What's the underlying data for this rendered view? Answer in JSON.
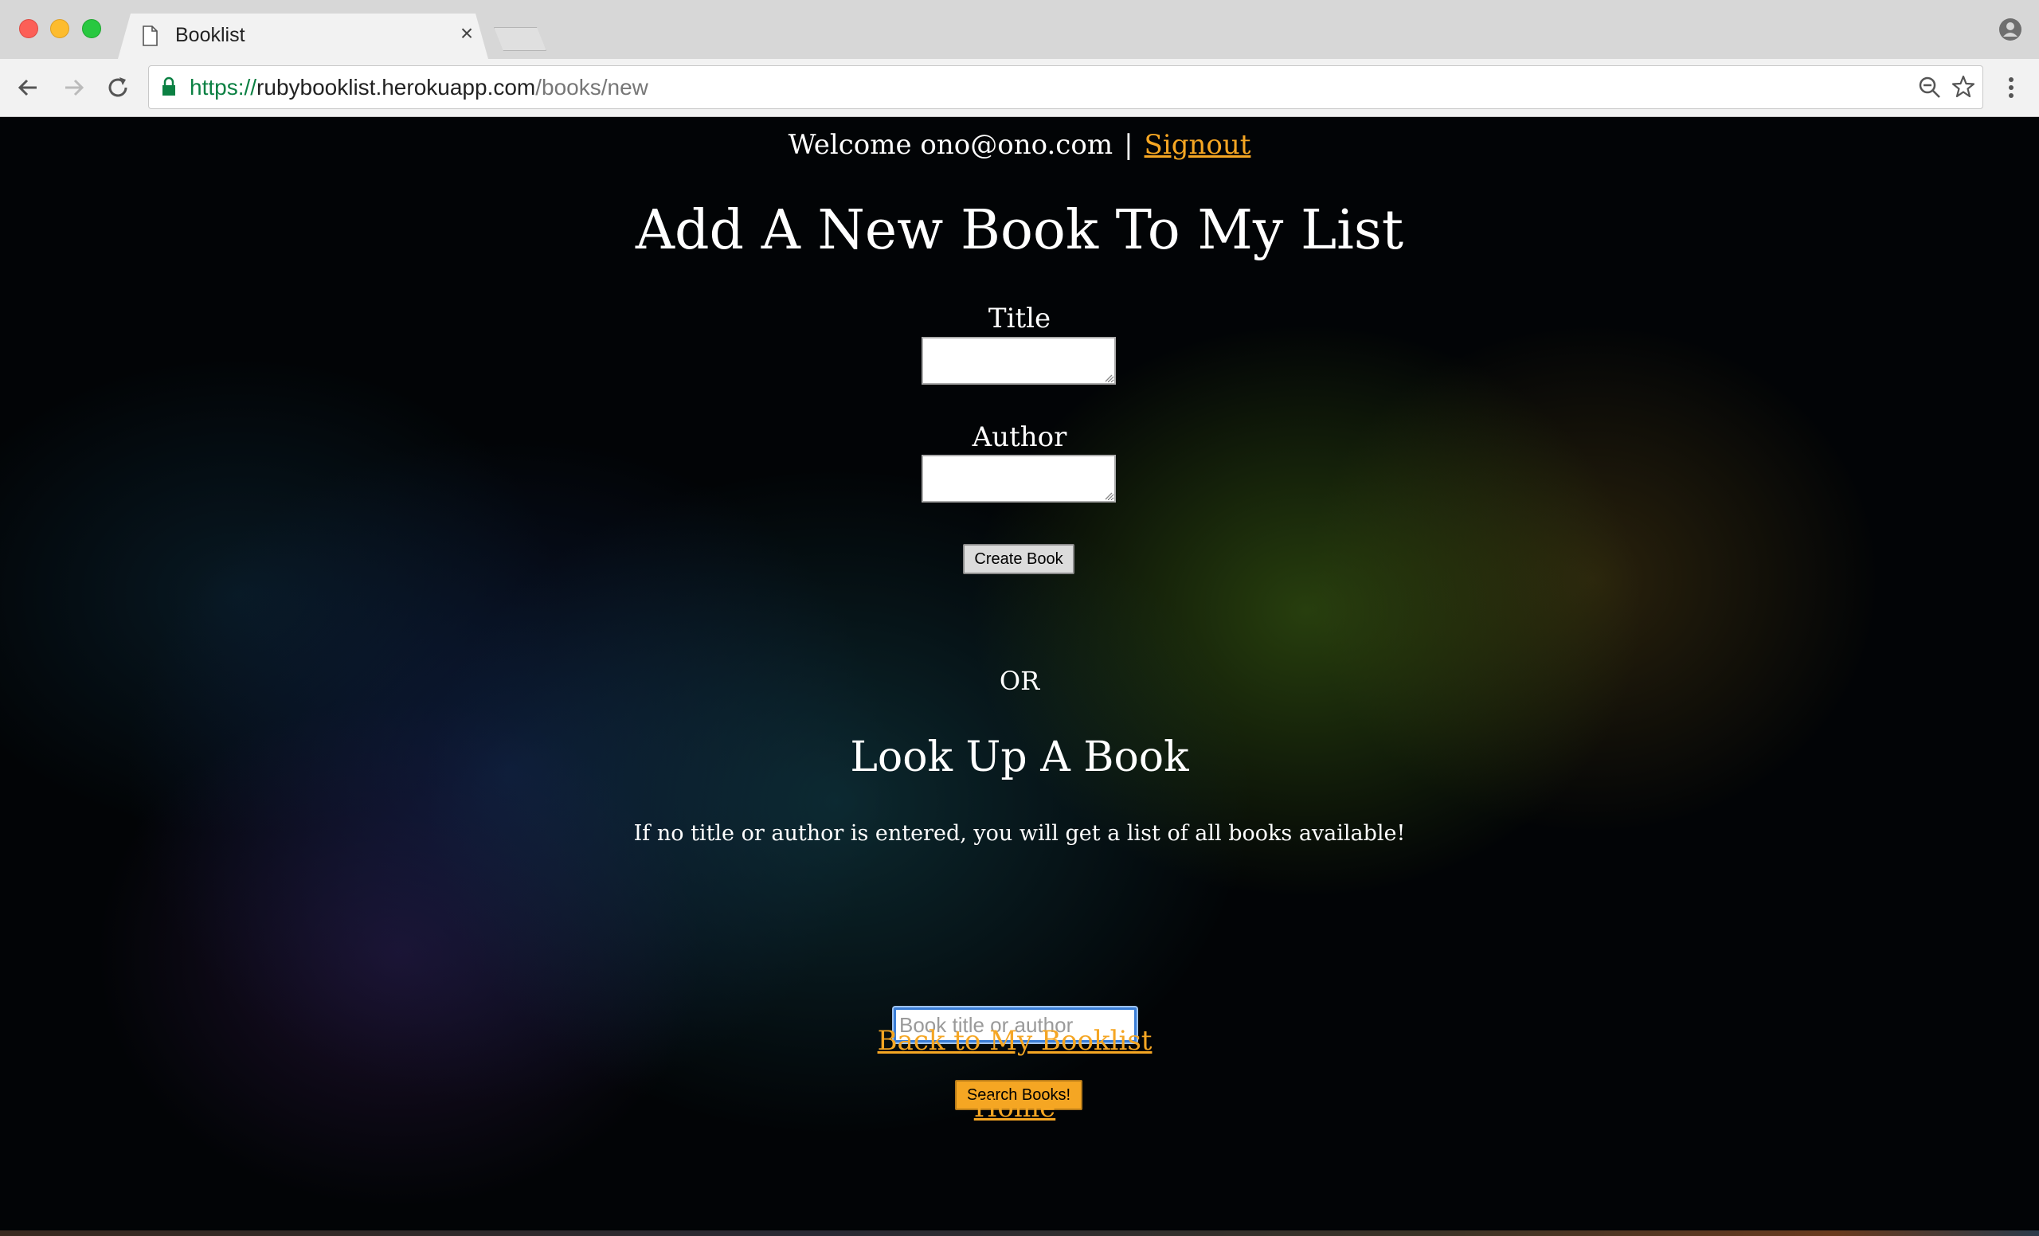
{
  "browser": {
    "tab_title": "Booklist",
    "tab_close": "×",
    "url_scheme": "https://",
    "url_host": "rubybooklist.herokuapp.com",
    "url_path": "/books/new",
    "icons": [
      "document-icon",
      "close-icon",
      "back-arrow-icon",
      "forward-arrow-icon",
      "reload-icon",
      "lock-icon",
      "zoom-icon",
      "star-icon",
      "menu-icon",
      "profile-icon"
    ]
  },
  "header": {
    "welcome": "Welcome ono@ono.com",
    "separator": "|",
    "signout": "Signout"
  },
  "add_form": {
    "heading": "Add A New Book To My List",
    "title_label": "Title",
    "author_label": "Author",
    "submit": "Create Book"
  },
  "divider": "OR",
  "lookup": {
    "heading": "Look Up A Book",
    "note": "If no title or author is entered, you will get a list of all books available!",
    "placeholder": "Book title or author",
    "submit": "Search Books!"
  },
  "links": {
    "back": "Back to My Booklist",
    "home": "Home"
  },
  "colors": {
    "link": "#f5a623",
    "search_button": "#f5a623",
    "focus_ring": "#3b7ed6",
    "secure_url": "#0b8043"
  }
}
